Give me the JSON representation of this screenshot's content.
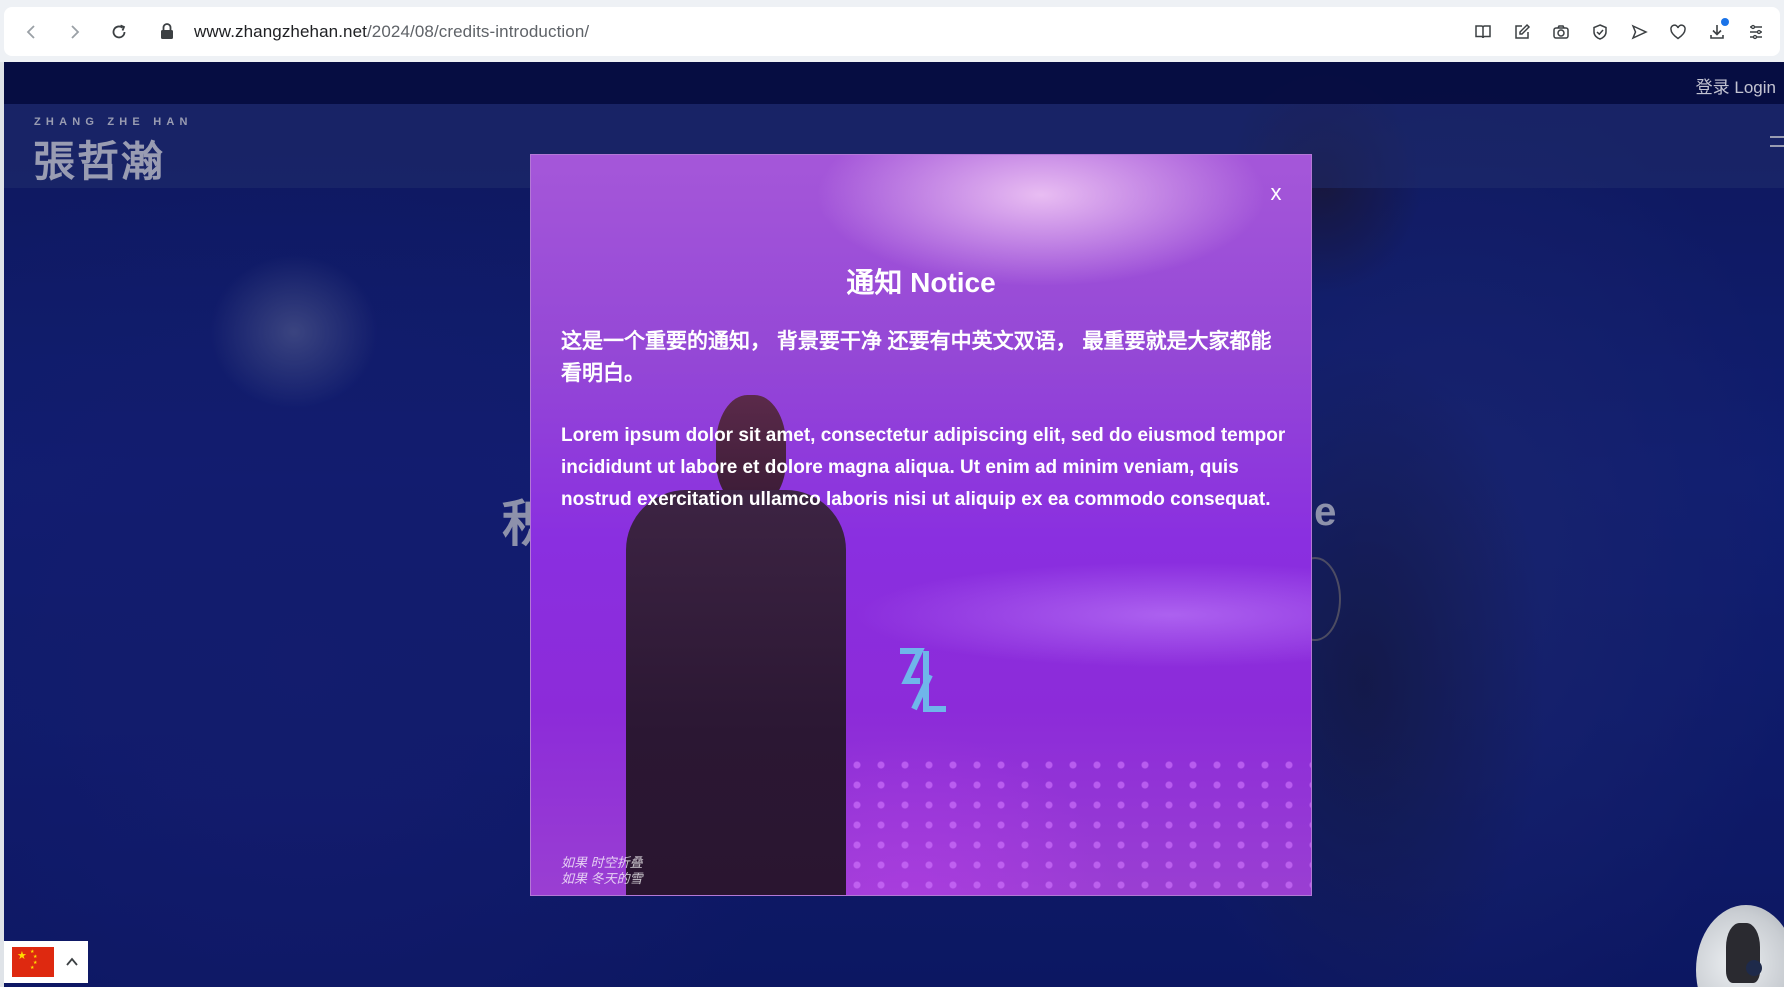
{
  "browser": {
    "url_host": "www.zhangzhehan.net",
    "url_path": "/2024/08/credits-introduction/",
    "toolbar_icons": [
      "reader-mode-icon",
      "edit-icon",
      "camera-icon",
      "shield-check-icon",
      "send-icon",
      "heart-icon",
      "download-icon",
      "menu-icon"
    ]
  },
  "site": {
    "login_label": "登录 Login",
    "logo_en": "ZHANG ZHE HAN",
    "logo_zh": "張哲瀚",
    "hero_left": "积",
    "hero_right": "le"
  },
  "modal": {
    "close_label": "x",
    "title": "通知 Notice",
    "body_zh": "这是一个重要的通知，  背景要干净 还要有中英文双语，  最重要就是大家都能看明白。",
    "body_en": "Lorem ipsum dolor sit amet, consectetur adipiscing elit, sed do eiusmod tempor incididunt ut labore et dolore magna aliqua. Ut enim ad minim veniam, quis nostrud exercitation ullamco laboris nisi ut aliquip ex ea commodo consequat.",
    "bottom_text_1": "如果 时空折叠",
    "bottom_text_2": "如果 冬天的雪",
    "logo_color": "#6fb6ea"
  },
  "colors": {
    "modal_purple": "#8a2fe0",
    "page_navy": "#12237f",
    "flag_red": "#de2910"
  }
}
